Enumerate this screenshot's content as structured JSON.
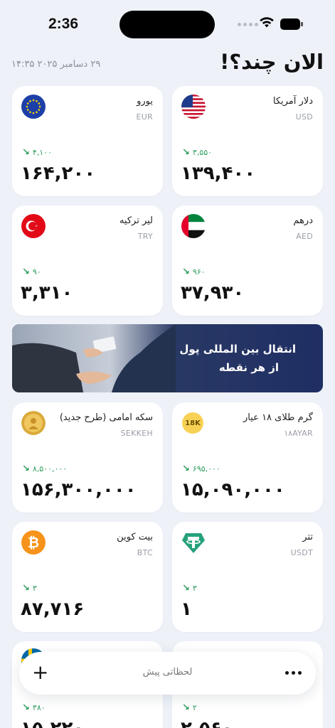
{
  "status_bar": {
    "time": "2:36",
    "icons": [
      "signal-dots-icon",
      "wifi-icon",
      "battery-icon"
    ]
  },
  "header": {
    "title": "الان چند؟!",
    "date": "۲۹ دسامبر ۲۰۲۵ ۱۴:۳۵"
  },
  "cards": [
    {
      "name": "دلار آمریکا",
      "code": "USD",
      "change": "۳,۵۵۰",
      "price": "۱۳۹,۴۰۰",
      "icon": "us-flag-icon"
    },
    {
      "name": "یورو",
      "code": "EUR",
      "change": "۴,۱۰۰",
      "price": "۱۶۴,۲۰۰",
      "icon": "eu-flag-icon"
    },
    {
      "name": "درهم",
      "code": "AED",
      "change": "۹۶۰",
      "price": "۳۷,۹۳۰",
      "icon": "uae-flag-icon"
    },
    {
      "name": "لیر ترکیه",
      "code": "TRY",
      "change": "۹۰",
      "price": "۳,۳۱۰",
      "icon": "turkey-flag-icon"
    },
    {
      "name": "گرم طلای ۱۸ عیار",
      "code": "۱۸AYAR",
      "change": "۶۹۵,۰۰۰",
      "price": "۱۵,۰۹۰,۰۰۰",
      "icon": "gold-18k-icon",
      "icon_text": "18K"
    },
    {
      "name": "سکه امامی (طرح جدید)",
      "code": "SEKKEH",
      "change": "۸,۵۰۰,۰۰۰",
      "price": "۱۵۶,۳۰۰,۰۰۰",
      "icon": "gold-coin-icon"
    },
    {
      "name": "تتر",
      "code": "USDT",
      "change": "۳",
      "price": "۱",
      "icon": "tether-icon"
    },
    {
      "name": "بیت کوین",
      "code": "BTC",
      "change": "۳",
      "price": "۸۷,۷۱۶",
      "icon": "bitcoin-icon"
    },
    {
      "name": "",
      "code": "",
      "change": "۲",
      "price": "۲,۵۶۰",
      "icon": ""
    },
    {
      "name": "",
      "code": "",
      "change": "۳۸۰",
      "price": "۱۵,۲۲۰",
      "icon": "sweden-flag-icon"
    }
  ],
  "banner": {
    "line1": "انتقال بین المللی پول",
    "line2": "از هر نقطه"
  },
  "bottom_bar": {
    "label": "لحظاتی پیش",
    "add_icon": "plus-icon",
    "more_icon": "more-icon"
  },
  "colors": {
    "background": "#eef1f8",
    "card": "#ffffff",
    "change_green": "#2e9e5e",
    "banner": "#1f2e63"
  }
}
